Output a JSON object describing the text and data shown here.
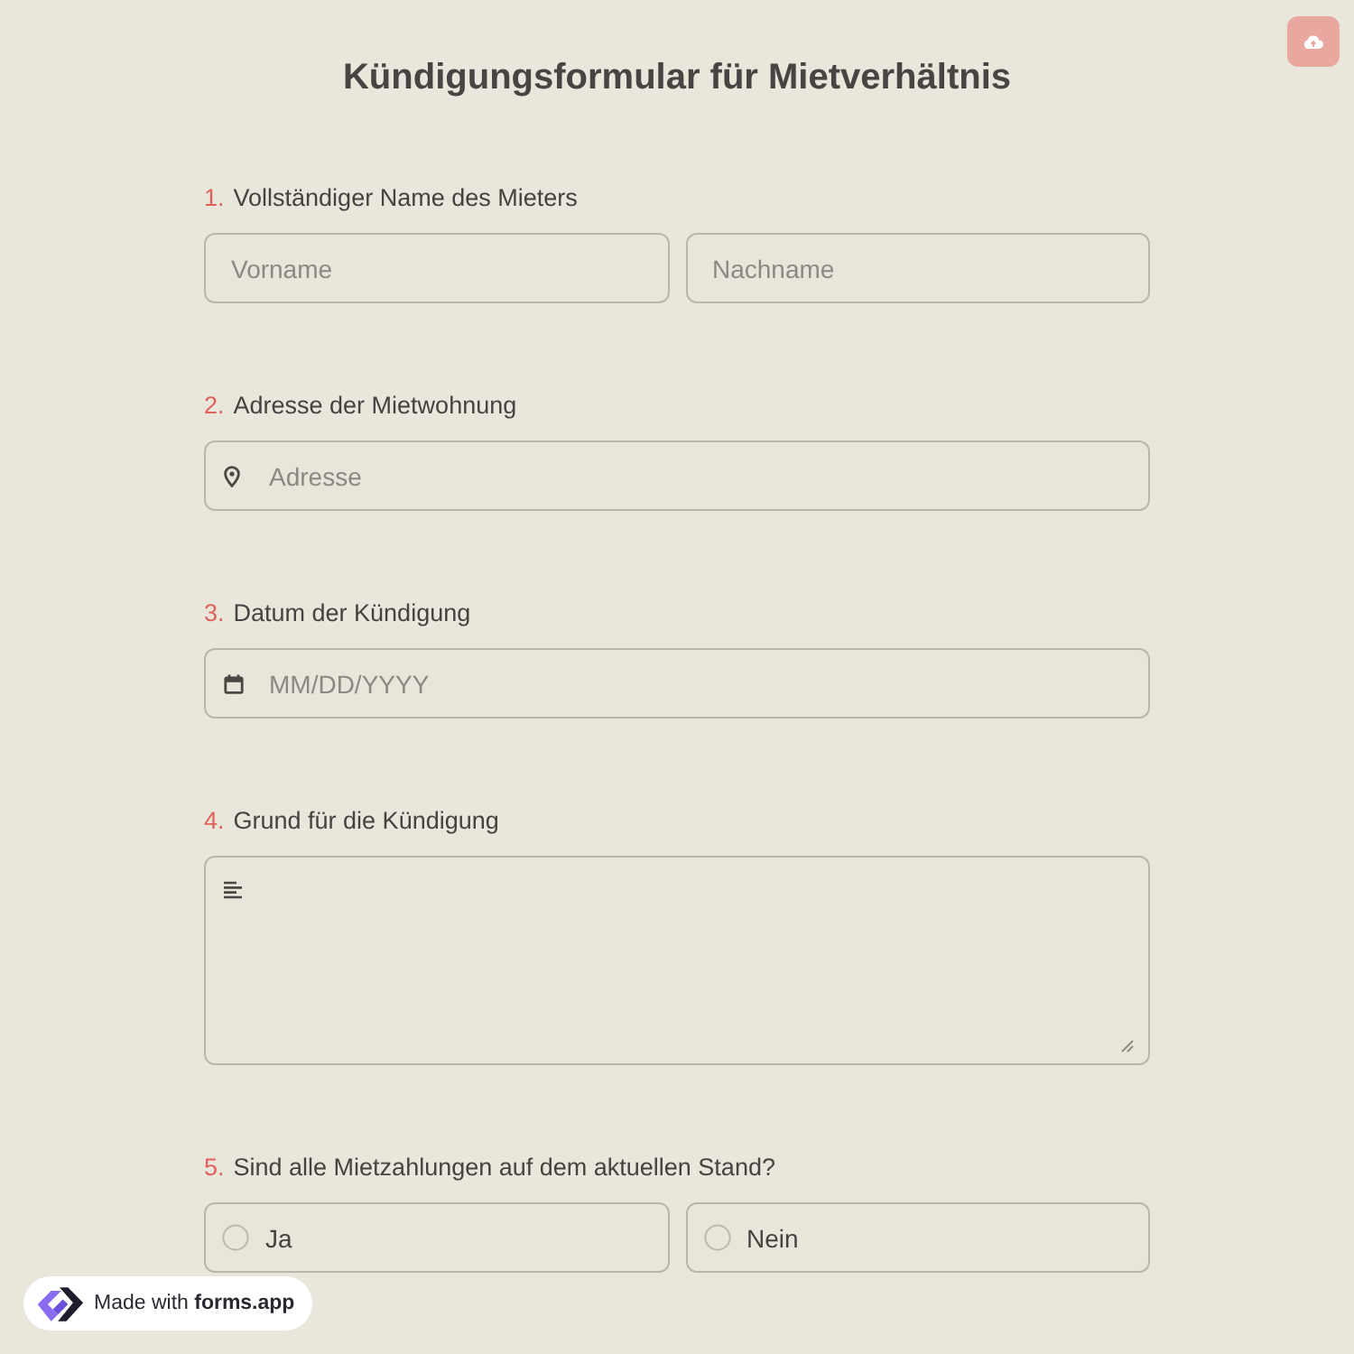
{
  "title": "Kündigungsformular für Mietverhältnis",
  "questions": [
    {
      "number": "1.",
      "label": "Vollständiger Name des Mieters",
      "kind": "name",
      "fields": [
        {
          "placeholder": "Vorname"
        },
        {
          "placeholder": "Nachname"
        }
      ]
    },
    {
      "number": "2.",
      "label": "Adresse der Mietwohnung",
      "kind": "address",
      "fields": [
        {
          "placeholder": "Adresse"
        }
      ]
    },
    {
      "number": "3.",
      "label": "Datum der Kündigung",
      "kind": "date",
      "fields": [
        {
          "placeholder": "MM/DD/YYYY"
        }
      ]
    },
    {
      "number": "4.",
      "label": "Grund für die Kündigung",
      "kind": "longtext"
    },
    {
      "number": "5.",
      "label": "Sind alle Mietzahlungen auf dem aktuellen Stand?",
      "kind": "choice",
      "options": [
        {
          "label": "Ja",
          "selected": false
        },
        {
          "label": "Nein",
          "selected": false
        }
      ]
    }
  ],
  "badge": {
    "text": "Made with **forms.app**"
  }
}
